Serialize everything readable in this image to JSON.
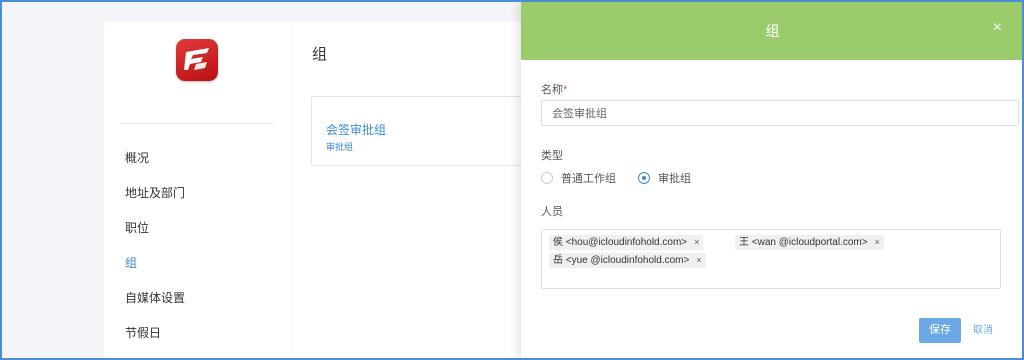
{
  "sidebar": {
    "logo": "app-logo",
    "items": [
      {
        "label": "概况",
        "active": false
      },
      {
        "label": "地址及部门",
        "active": false
      },
      {
        "label": "职位",
        "active": false
      },
      {
        "label": "组",
        "active": true
      },
      {
        "label": "自媒体设置",
        "active": false
      },
      {
        "label": "节假日",
        "active": false
      }
    ]
  },
  "main": {
    "title": "组",
    "group_card": {
      "name": "会签审批组",
      "type": "审批组"
    }
  },
  "modal": {
    "title": "组",
    "close_icon": "×",
    "name_label": "名称",
    "required_mark": "*",
    "name_value": "会签审批组",
    "type_label": "类型",
    "type_options": [
      {
        "label": "普通工作组",
        "checked": false
      },
      {
        "label": "审批组",
        "checked": true
      }
    ],
    "members_label": "人员",
    "members": [
      {
        "text": "侯 <hou@icloudinfohold.com>",
        "remove": "×"
      },
      {
        "text": "王 <wan @icloudportal.com>",
        "remove": "×"
      },
      {
        "text": "岳 <yue @icloudinfohold.com>",
        "remove": "×"
      }
    ],
    "save_label": "保存",
    "cancel_label": "取消"
  },
  "colors": {
    "accent": "#3b8bd8",
    "header_green": "#9ccb6c",
    "save_button": "#6aa8e6",
    "required": "#e04b4b"
  }
}
